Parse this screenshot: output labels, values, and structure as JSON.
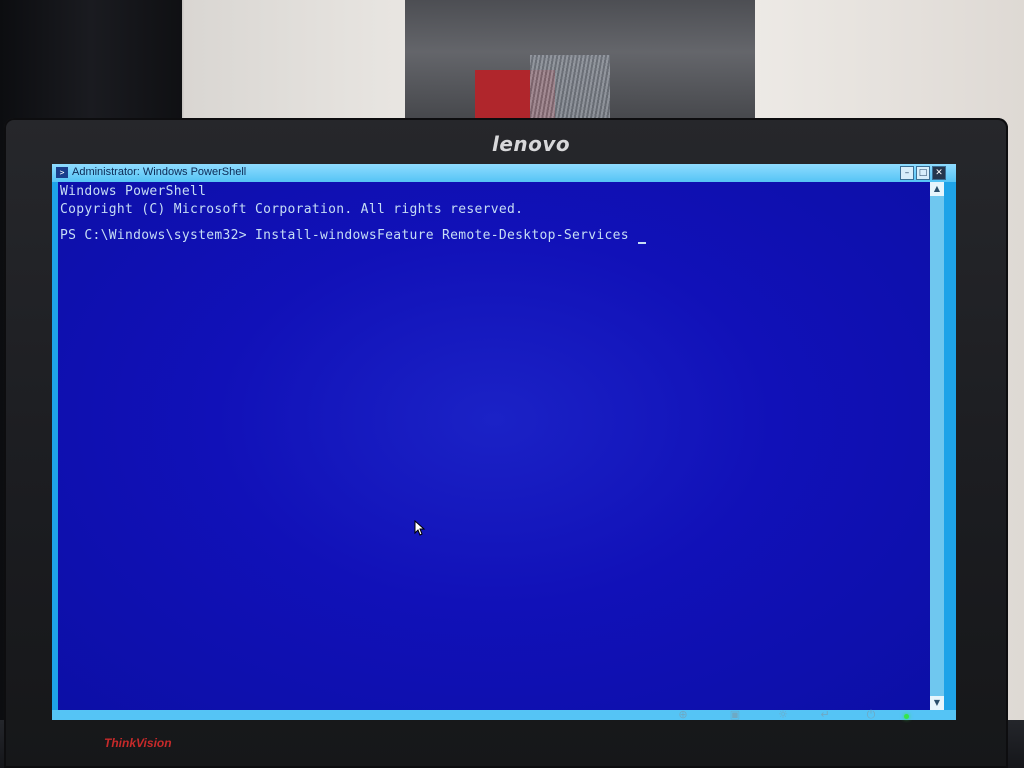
{
  "window": {
    "title": "Administrator: Windows PowerShell",
    "icon_name": "powershell-icon",
    "buttons": {
      "minimize": "–",
      "maximize": "□",
      "close": "✕"
    }
  },
  "console": {
    "lines": [
      "Windows PowerShell",
      "Copyright (C) Microsoft Corporation. All rights reserved.",
      "",
      "PS C:\\Windows\\system32> Install-windowsFeature Remote-Desktop-Services"
    ],
    "background_color": "#1111b8",
    "text_color": "#c6ddf5"
  },
  "monitor": {
    "brand": "lenovo",
    "model": "ThinkVision"
  },
  "scrollbar": {
    "up_arrow": "▲",
    "down_arrow": "▼"
  },
  "colors": {
    "window_frame": "#1ea3e8",
    "titlebar": "#55c4f5",
    "power_led": "#35e54a"
  }
}
